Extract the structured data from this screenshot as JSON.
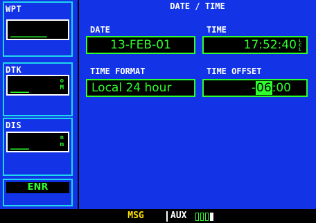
{
  "left_panel": {
    "wpt": {
      "label": "WPT",
      "value": "______"
    },
    "dtk": {
      "label": "DTK",
      "value": "___",
      "unit_top": "o",
      "unit_bot": "M"
    },
    "dis": {
      "label": "DIS",
      "value": "___",
      "unit_top": "n",
      "unit_bot": "m"
    },
    "mode": "ENR"
  },
  "main": {
    "title": "DATE / TIME",
    "date": {
      "label": "DATE",
      "value": "13-FEB-01"
    },
    "time": {
      "label": "TIME",
      "value": "17:52:40",
      "suffix": "LCL"
    },
    "time_format": {
      "label": "TIME FORMAT",
      "value": "Local 24 hour"
    },
    "time_offset": {
      "label": "TIME OFFSET",
      "sign": "-",
      "hours": "06",
      "rest": ":00"
    }
  },
  "status_bar": {
    "msg": "MSG",
    "aux": "AUX",
    "pages_total": 4,
    "page_active": 4
  },
  "colors": {
    "panel_blue": "#1234e6",
    "field_green": "#2dff2d",
    "border_cyan": "#20d8ee",
    "msg_yellow": "#ffe200"
  }
}
